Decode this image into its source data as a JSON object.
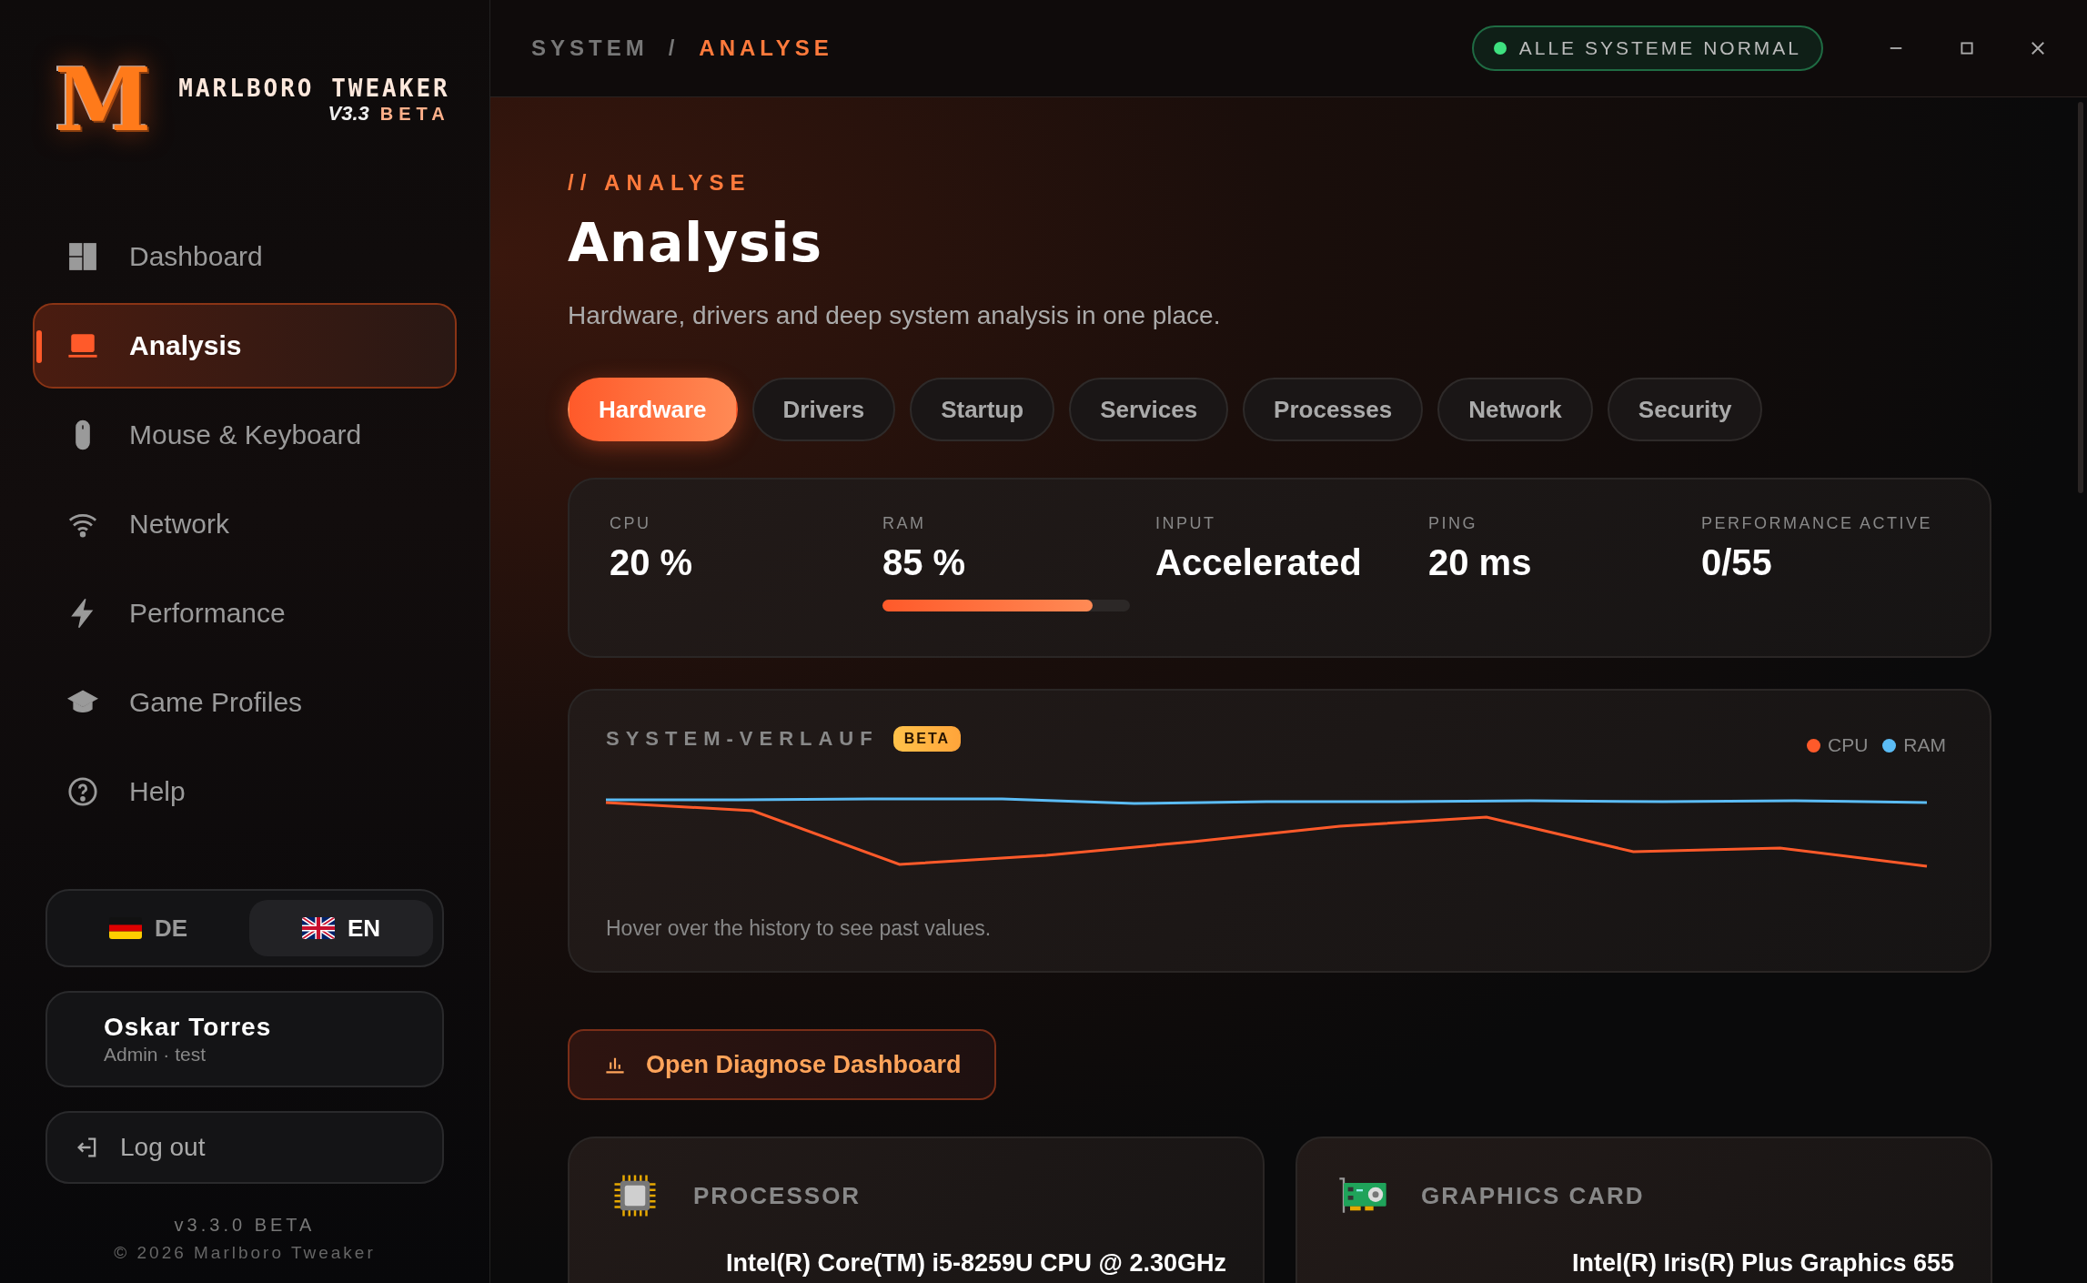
{
  "app": {
    "logo_letter": "M",
    "name": "MARLBORO TWEAKER",
    "version": "V3.3",
    "badge": "BETA"
  },
  "sidebar": {
    "items": [
      {
        "label": "Dashboard",
        "selected": false
      },
      {
        "label": "Analysis",
        "selected": true
      },
      {
        "label": "Mouse & Keyboard",
        "selected": false
      },
      {
        "label": "Network",
        "selected": false
      },
      {
        "label": "Performance",
        "selected": false
      },
      {
        "label": "Game Profiles",
        "selected": false
      },
      {
        "label": "Help",
        "selected": false
      }
    ],
    "languages": [
      {
        "code": "DE",
        "selected": false
      },
      {
        "code": "EN",
        "selected": true
      }
    ],
    "user": {
      "name": "Oskar Torres",
      "role": "Admin · test"
    },
    "logout": "Log out",
    "version": "v3.3.0 BETA",
    "copyright": "© 2026 Marlboro Tweaker"
  },
  "header": {
    "breadcrumb": [
      "SYSTEM",
      "/",
      "ANALYSE"
    ],
    "status": "ALLE SYSTEME NORMAL"
  },
  "page": {
    "eyebrow": "// ANALYSE",
    "title": "Analysis",
    "subtitle": "Hardware, drivers and deep system analysis in one place."
  },
  "tabs": [
    {
      "label": "Hardware",
      "selected": true
    },
    {
      "label": "Drivers",
      "selected": false
    },
    {
      "label": "Startup",
      "selected": false
    },
    {
      "label": "Services",
      "selected": false
    },
    {
      "label": "Processes",
      "selected": false
    },
    {
      "label": "Network",
      "selected": false
    },
    {
      "label": "Security",
      "selected": false
    }
  ],
  "metrics": [
    {
      "label": "CPU",
      "value": "20 %"
    },
    {
      "label": "RAM",
      "value": "85 %",
      "level": 0.85
    },
    {
      "label": "INPUT",
      "value": "Accelerated"
    },
    {
      "label": "PING",
      "value": "20 ms"
    },
    {
      "label": "PERFORMANCE ACTIVE",
      "value": "0/55"
    }
  ],
  "history": {
    "title": "SYSTEM-VERLAUF",
    "badge": "BETA",
    "legend": [
      {
        "name": "CPU",
        "color": "#ff5a2a"
      },
      {
        "name": "RAM",
        "color": "#5bbcf5"
      }
    ],
    "hint": "Hover over the history to see past values."
  },
  "diagnose_button": "Open Diagnose Dashboard",
  "hardware": [
    {
      "title": "PROCESSOR",
      "model": "Intel(R) Core(TM) i5-8259U CPU @ 2.30GHz"
    },
    {
      "title": "GRAPHICS CARD",
      "model": "Intel(R) Iris(R) Plus Graphics 655"
    }
  ]
}
